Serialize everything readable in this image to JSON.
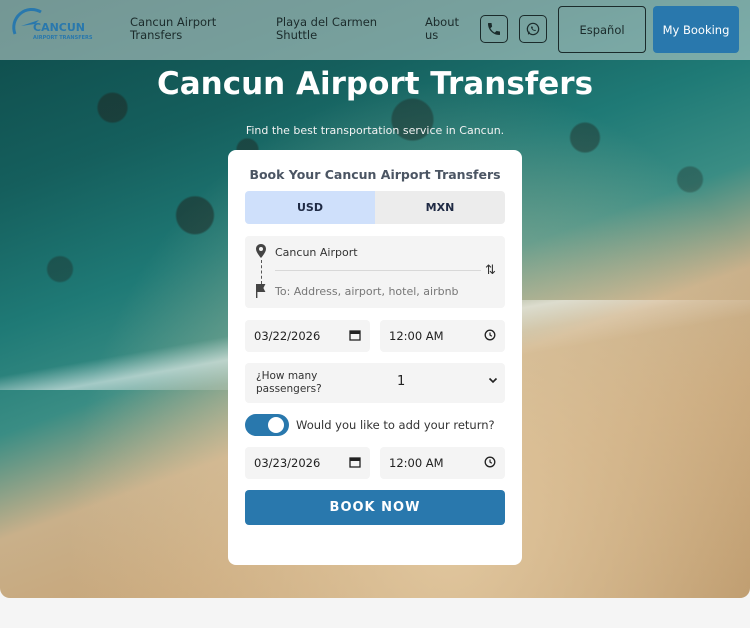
{
  "nav": {
    "logo_text": "CANCUN",
    "logo_sub": "AIRPORT TRANSFERS",
    "links": [
      "Cancun Airport Transfers",
      "Playa del Carmen Shuttle",
      "About us"
    ],
    "phone_icon": "phone-icon",
    "whatsapp_icon": "whatsapp-icon",
    "language_label": "Español",
    "booking_label": "My Booking"
  },
  "hero": {
    "title": "Cancun Airport Transfers",
    "subtitle": "Find the best transportation service in Cancun."
  },
  "form": {
    "title": "Book Your Cancun Airport Transfers",
    "currencies": [
      "USD",
      "MXN"
    ],
    "selected_currency": "USD",
    "from_value": "Cancun Airport",
    "to_placeholder": "To: Address, airport, hotel, airbnb",
    "date1": "03/22/2026",
    "time1": "12:00 AM",
    "passengers_label": "¿How many passengers?",
    "passengers_value": "1",
    "return_label": "Would you like to add your return?",
    "return_enabled": true,
    "date2": "03/23/2026",
    "time2": "12:00 AM",
    "submit_label": "BOOK NOW"
  },
  "colors": {
    "accent": "#2978ad",
    "usd_selected": "#cfe0fb"
  }
}
